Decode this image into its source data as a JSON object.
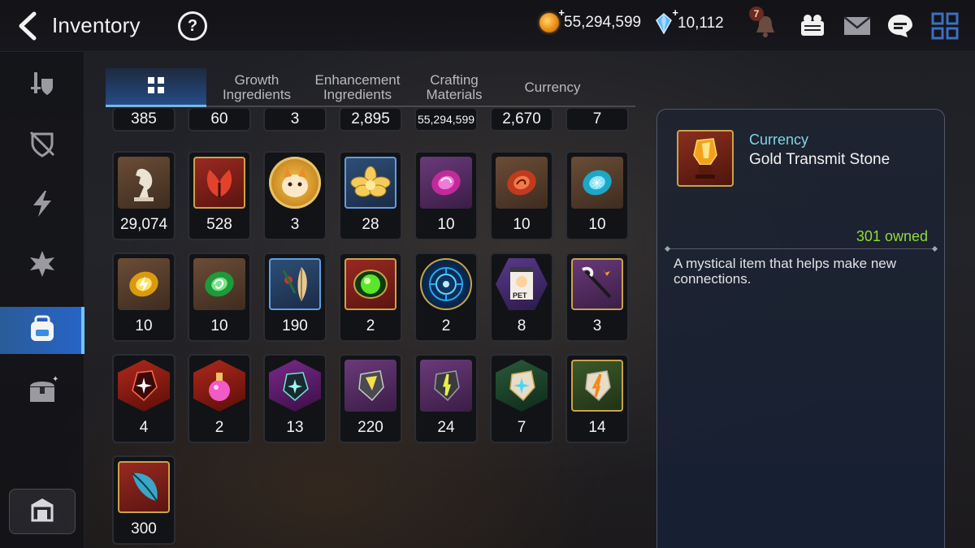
{
  "header": {
    "title": "Inventory",
    "help_label": "?",
    "gold_amount": "55,294,599",
    "gem_amount": "10,112",
    "notification_count": "7",
    "icons": [
      "back-arrow-icon",
      "help-icon",
      "gold-coin-icon",
      "crystal-gem-icon",
      "bell-icon",
      "friends-icon",
      "mail-icon",
      "chat-icon",
      "menu-grid-icon"
    ]
  },
  "sidebar": {
    "items": [
      {
        "icon": "equipment-shield-icon",
        "active": false
      },
      {
        "icon": "broken-shield-icon",
        "active": false
      },
      {
        "icon": "lightning-icon",
        "active": false
      },
      {
        "icon": "artifact-icon",
        "active": false
      },
      {
        "icon": "backpack-icon",
        "active": true
      },
      {
        "icon": "chest-icon",
        "active": false
      }
    ],
    "bottom_icon": "shop-icon"
  },
  "tabs": [
    {
      "label": "",
      "icon": "grid-icon",
      "active": true
    },
    {
      "label": "Growth Ingredients",
      "active": false
    },
    {
      "label": "Enhancement Ingredients",
      "active": false
    },
    {
      "label": "Crafting Materials",
      "active": false
    },
    {
      "label": "Currency",
      "active": false
    }
  ],
  "grid": {
    "top_row": [
      "385",
      "60",
      "3",
      "2,895",
      "55,294,599",
      "2,670",
      "7"
    ],
    "rows": [
      [
        {
          "count": "29,074",
          "icon": "horse-statue-icon"
        },
        {
          "count": "528",
          "icon": "red-leaf-icon"
        },
        {
          "count": "3",
          "icon": "fox-pet-icon"
        },
        {
          "count": "28",
          "icon": "gold-lotus-icon"
        },
        {
          "count": "10",
          "icon": "purple-rune-icon"
        },
        {
          "count": "10",
          "icon": "red-rune-icon"
        },
        {
          "count": "10",
          "icon": "blue-rune-icon"
        }
      ],
      [
        {
          "count": "10",
          "icon": "yellow-rune-icon"
        },
        {
          "count": "10",
          "icon": "green-rune-icon"
        },
        {
          "count": "190",
          "icon": "feather-charm-icon"
        },
        {
          "count": "2",
          "icon": "green-orb-icon"
        },
        {
          "count": "2",
          "icon": "blue-portal-icon"
        },
        {
          "count": "8",
          "icon": "pet-pack-icon",
          "label": "PET"
        },
        {
          "count": "3",
          "icon": "wand-icon"
        }
      ],
      [
        {
          "count": "4",
          "icon": "red-stone-icon"
        },
        {
          "count": "2",
          "icon": "pink-potion-icon"
        },
        {
          "count": "13",
          "icon": "teal-stone-icon"
        },
        {
          "count": "220",
          "icon": "yellow-transmit-stone-icon"
        },
        {
          "count": "24",
          "icon": "green-transmit-stone-icon"
        },
        {
          "count": "7",
          "icon": "star-stone-icon"
        },
        {
          "count": "14",
          "icon": "orange-transmit-stone-icon"
        }
      ],
      [
        {
          "count": "300",
          "icon": "blue-feather-icon"
        }
      ]
    ]
  },
  "detail": {
    "category": "Currency",
    "name": "Gold Transmit Stone",
    "owned": "301 owned",
    "description": "A mystical item that helps make new connections.",
    "icon": "gold-transmit-stone-icon"
  }
}
